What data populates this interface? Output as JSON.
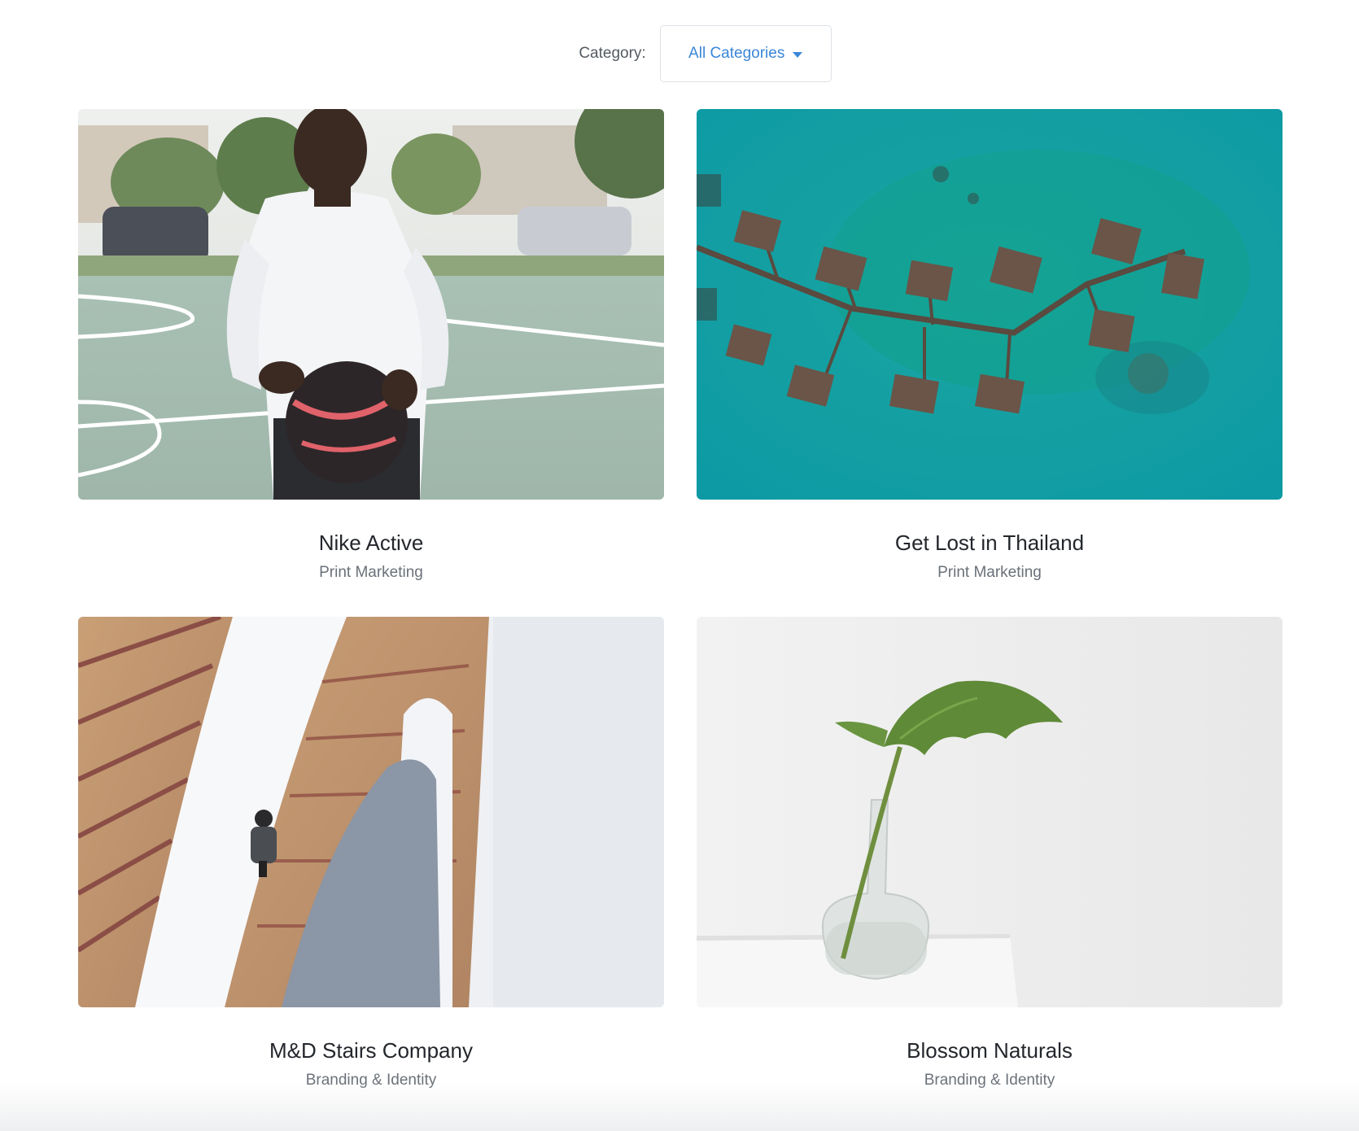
{
  "filter": {
    "label": "Category:",
    "selected": "All Categories",
    "caret_icon": "caret-down-icon"
  },
  "projects": [
    {
      "title": "Nike Active",
      "category": "Print Marketing",
      "image": "basketball-player-photo"
    },
    {
      "title": "Get Lost in Thailand",
      "category": "Print Marketing",
      "image": "overwater-bungalows-aerial-photo"
    },
    {
      "title": "M&D Stairs Company",
      "category": "Branding & Identity",
      "image": "spiral-staircase-photo"
    },
    {
      "title": "Blossom Naturals",
      "category": "Branding & Identity",
      "image": "leaf-in-vase-photo"
    }
  ],
  "colors": {
    "accent": "#3b86d8",
    "title_text": "#23262b",
    "subtitle_text": "#6b7179",
    "border": "#dde1e6"
  }
}
